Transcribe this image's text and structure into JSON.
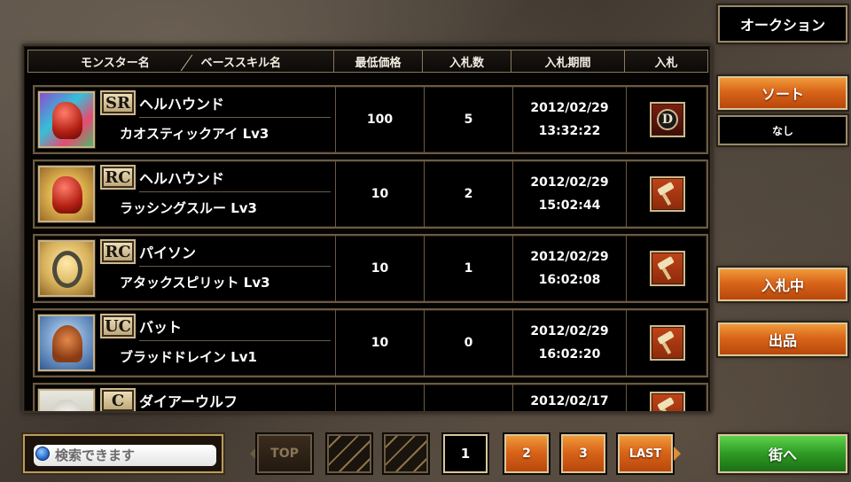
{
  "header": {
    "title": "オークション",
    "columns": {
      "monster_name": "モンスター名",
      "base_skill": "ベーススキル名",
      "min_price": "最低価格",
      "bid_count": "入札数",
      "bid_period": "入札期間",
      "bid": "入札"
    }
  },
  "listings": [
    {
      "rarity": "SR",
      "monster": "ヘルハウンド",
      "skill": "カオスティックアイ Lv3",
      "price": "100",
      "bids": "5",
      "date": "2012/02/29",
      "time": "13:32:22",
      "action_icon": "d-badge-icon"
    },
    {
      "rarity": "RC",
      "monster": "ヘルハウンド",
      "skill": "ラッシングスルー Lv3",
      "price": "10",
      "bids": "2",
      "date": "2012/02/29",
      "time": "15:02:44",
      "action_icon": "hammer-icon"
    },
    {
      "rarity": "RC",
      "monster": "パイソン",
      "skill": "アタックスピリット Lv3",
      "price": "10",
      "bids": "1",
      "date": "2012/02/29",
      "time": "16:02:08",
      "action_icon": "hammer-icon"
    },
    {
      "rarity": "UC",
      "monster": "バット",
      "skill": "ブラッドドレイン Lv1",
      "price": "10",
      "bids": "0",
      "date": "2012/02/29",
      "time": "16:02:20",
      "action_icon": "hammer-icon"
    },
    {
      "rarity": "C",
      "monster": "ダイアーウルフ",
      "skill": "",
      "price": "",
      "bids": "",
      "date": "2012/02/17",
      "time": "",
      "action_icon": "hammer-icon"
    }
  ],
  "sidebar": {
    "sort_label": "ソート",
    "sort_value": "なし",
    "bidding_label": "入札中",
    "listing_label": "出品",
    "town_label": "街へ"
  },
  "search": {
    "placeholder": "検索できます"
  },
  "pagination": {
    "top_label": "TOP",
    "current": "1",
    "page2": "2",
    "page3": "3",
    "last_label": "LAST"
  },
  "colors": {
    "accent_orange": "#d9651a",
    "accent_green": "#2d9b23",
    "frame_gold": "#cdb98e"
  }
}
